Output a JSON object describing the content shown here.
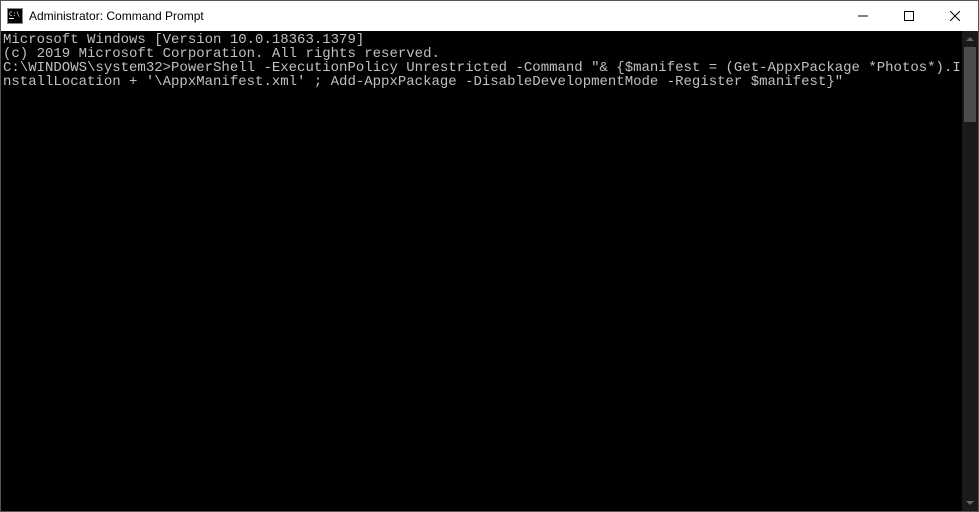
{
  "window": {
    "title": "Administrator: Command Prompt"
  },
  "terminal": {
    "lines": [
      "Microsoft Windows [Version 10.0.18363.1379]",
      "(c) 2019 Microsoft Corporation. All rights reserved.",
      "",
      "C:\\WINDOWS\\system32>PowerShell -ExecutionPolicy Unrestricted -Command \"& {$manifest = (Get-AppxPackage *Photos*).InstallLocation + '\\AppxManifest.xml' ; Add-AppxPackage -DisableDevelopmentMode -Register $manifest}\""
    ]
  }
}
